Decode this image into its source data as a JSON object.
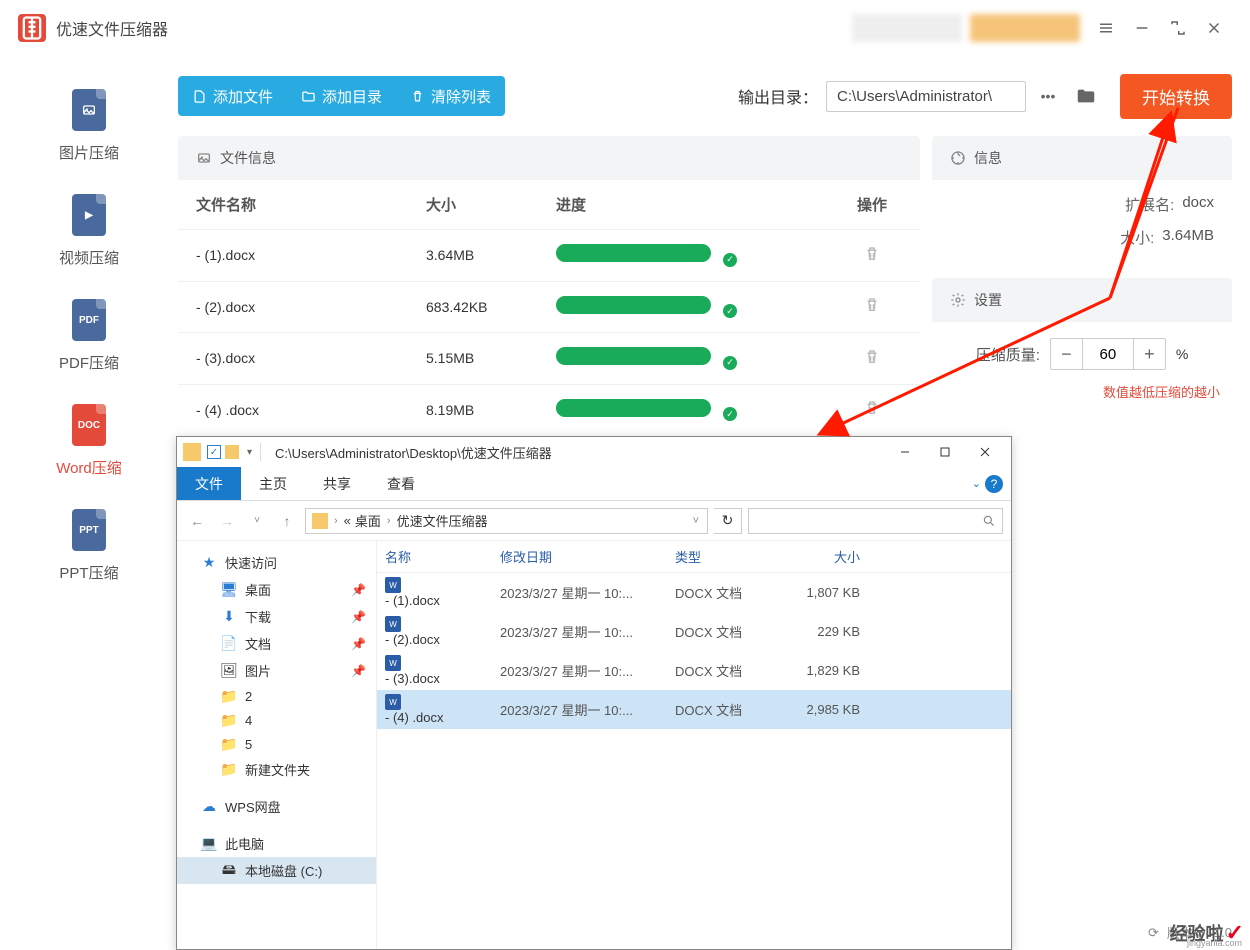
{
  "app": {
    "title": "优速文件压缩器",
    "version_label": "版本号",
    "version": "1.0"
  },
  "window_controls": {
    "menu": "menu",
    "minimize": "minimize",
    "maximize": "maximize",
    "close": "close"
  },
  "sidebar": {
    "items": [
      {
        "label": "图片压缩",
        "badge": ""
      },
      {
        "label": "视频压缩",
        "badge": "▶"
      },
      {
        "label": "PDF压缩",
        "badge": "PDF"
      },
      {
        "label": "Word压缩",
        "badge": "DOC"
      },
      {
        "label": "PPT压缩",
        "badge": "PPT"
      }
    ],
    "active_index": 3
  },
  "toolbar": {
    "add_file": "添加文件",
    "add_dir": "添加目录",
    "clear_list": "清除列表",
    "output_label": "输出目录：",
    "output_path": "C:\\Users\\Administrator\\",
    "start": "开始转换"
  },
  "file_panel": {
    "header": "文件信息",
    "columns": {
      "name": "文件名称",
      "size": "大小",
      "progress": "进度",
      "op": "操作"
    },
    "rows": [
      {
        "name": "- (1).docx",
        "size": "3.64MB"
      },
      {
        "name": "- (2).docx",
        "size": "683.42KB"
      },
      {
        "name": "- (3).docx",
        "size": "5.15MB"
      },
      {
        "name": "- (4) .docx",
        "size": "8.19MB"
      }
    ]
  },
  "info_panel": {
    "header": "信息",
    "ext_label": "扩展名:",
    "ext_value": "docx",
    "size_label": "大小:",
    "size_value": "3.64MB"
  },
  "settings_panel": {
    "header": "设置",
    "quality_label": "压缩质量:",
    "quality_value": "60",
    "percent": "%",
    "hint": "数值越低压缩的越小"
  },
  "explorer": {
    "title_path": "C:\\Users\\Administrator\\Desktop\\优速文件压缩器",
    "ribbon": {
      "file": "文件",
      "home": "主页",
      "share": "共享",
      "view": "查看"
    },
    "breadcrumb": [
      "«",
      "桌面",
      "优速文件压缩器"
    ],
    "refresh": "↻",
    "columns": {
      "name": "名称",
      "date": "修改日期",
      "type": "类型",
      "size": "大小"
    },
    "side": {
      "quick": "快速访问",
      "desktop": "桌面",
      "downloads": "下载",
      "documents": "文档",
      "pictures": "图片",
      "f2": "2",
      "f4": "4",
      "f5": "5",
      "new_folder": "新建文件夹",
      "wps": "WPS网盘",
      "thispc": "此电脑",
      "cdrive": "本地磁盘 (C:)"
    },
    "rows": [
      {
        "name": "- (1).docx",
        "date": "2023/3/27 星期一 10:...",
        "type": "DOCX 文档",
        "size": "1,807 KB"
      },
      {
        "name": "- (2).docx",
        "date": "2023/3/27 星期一 10:...",
        "type": "DOCX 文档",
        "size": "229 KB"
      },
      {
        "name": "- (3).docx",
        "date": "2023/3/27 星期一 10:...",
        "type": "DOCX 文档",
        "size": "1,829 KB"
      },
      {
        "name": "- (4) .docx",
        "date": "2023/3/27 星期一 10:...",
        "type": "DOCX 文档",
        "size": "2,985 KB"
      }
    ],
    "selected_index": 3
  },
  "watermark": {
    "text": "经验啦",
    "sub": "jingyanla.com"
  }
}
